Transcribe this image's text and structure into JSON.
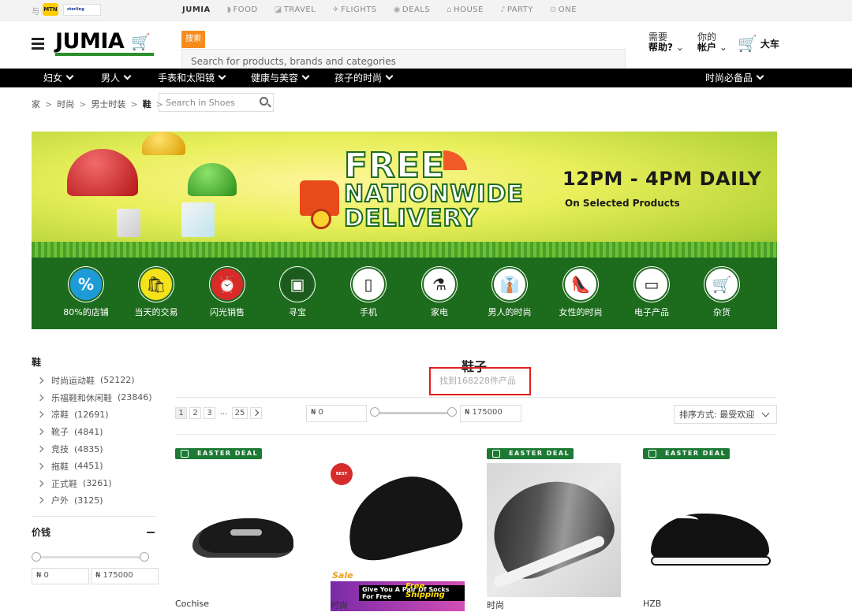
{
  "top_strip": {
    "yu": "与",
    "mtn": "MTN",
    "bank": "sterling",
    "links": [
      {
        "label": "JUMIA",
        "icon": "jumia-icon"
      },
      {
        "label": "FOOD",
        "icon": "food-icon"
      },
      {
        "label": "TRAVEL",
        "icon": "travel-icon"
      },
      {
        "label": "FLIGHTS",
        "icon": "flights-icon"
      },
      {
        "label": "DEALS",
        "icon": "deals-icon"
      },
      {
        "label": "HOUSE",
        "icon": "house-icon"
      },
      {
        "label": "PARTY",
        "icon": "party-icon"
      },
      {
        "label": "ONE",
        "icon": "one-icon"
      }
    ]
  },
  "header": {
    "logo": "JUMIA",
    "search_button": "搜索",
    "search_placeholder": "Search for products, brands and categories",
    "help_line1": "需要",
    "help_line2": "帮助?",
    "account_line1": "你的",
    "account_line2": "帐户",
    "cart_label": "大车"
  },
  "nav": {
    "items": [
      "妇女",
      "男人",
      "手表和太阳镜",
      "健康与美容",
      "孩子的时尚"
    ],
    "right_item": "时尚必备品"
  },
  "breadcrumb": {
    "items": [
      "家",
      "时尚",
      "男士时装",
      "鞋"
    ],
    "search_placeholder": "Search in Shoes"
  },
  "banner": {
    "line1": "FREE",
    "line2": "NATIONWIDE",
    "line3": "DELIVERY",
    "hours": "12PM - 4PM DAILY",
    "subtitle": "On Selected Products",
    "categories": [
      {
        "label": "80%的店铺",
        "icon": "percent-icon",
        "glyph": "%",
        "color": "#1e9bd7"
      },
      {
        "label": "当天的交易",
        "icon": "shopping-bag-icon",
        "glyph": "🛍",
        "color": "#f5e21a"
      },
      {
        "label": "闪光销售",
        "icon": "flash-sale-icon",
        "glyph": "⏰",
        "color": "#d92a2a"
      },
      {
        "label": "寻宝",
        "icon": "treasure-chest-icon",
        "glyph": "▣",
        "color": "#1d6b1d"
      },
      {
        "label": "手机",
        "icon": "phone-icon",
        "glyph": "▯",
        "color": "#ffffff"
      },
      {
        "label": "家电",
        "icon": "blender-icon",
        "glyph": "⚗",
        "color": "#ffffff"
      },
      {
        "label": "男人的时尚",
        "icon": "shirt-icon",
        "glyph": "👔",
        "color": "#ffffff"
      },
      {
        "label": "女性的时尚",
        "icon": "heel-icon",
        "glyph": "👠",
        "color": "#ffffff"
      },
      {
        "label": "电子产品",
        "icon": "monitor-icon",
        "glyph": "▭",
        "color": "#ffffff"
      },
      {
        "label": "杂货",
        "icon": "grocery-bag-icon",
        "glyph": "🛒",
        "color": "#ffffff"
      }
    ]
  },
  "sidebar": {
    "title": "鞋",
    "items": [
      {
        "label": "时尚运动鞋",
        "count": "(52122)"
      },
      {
        "label": "乐福鞋和休闲鞋",
        "count": "(23846)"
      },
      {
        "label": "凉鞋",
        "count": "(12691)"
      },
      {
        "label": "靴子",
        "count": "(4841)"
      },
      {
        "label": "竞技",
        "count": "(4835)"
      },
      {
        "label": "拖鞋",
        "count": "(4451)"
      },
      {
        "label": "正式鞋",
        "count": "(3261)"
      },
      {
        "label": "户外",
        "count": "(3125)"
      }
    ],
    "price_title": "价钱",
    "price_min": "₦ 0",
    "price_max": "₦ 175000"
  },
  "main": {
    "title": "鞋子",
    "found": "找到168228件产品",
    "pages": [
      "1",
      "2",
      "3",
      "...",
      "25"
    ],
    "price_min": "₦ 0",
    "price_max": "₦ 175000",
    "sort_label": "排序方式: 最受欢迎"
  },
  "products": [
    {
      "badge": "EASTER DEAL",
      "name": "Cochise"
    },
    {
      "badge": "",
      "name": "时尚",
      "bestseller": "BEST SELLER",
      "promo_left": "Give You A Pair Of Socks For Free",
      "promo_right": "Free Shipping",
      "promo_tag": "Sale"
    },
    {
      "badge": "EASTER DEAL",
      "name": "时尚"
    },
    {
      "badge": "EASTER DEAL",
      "name": "HZB"
    }
  ]
}
